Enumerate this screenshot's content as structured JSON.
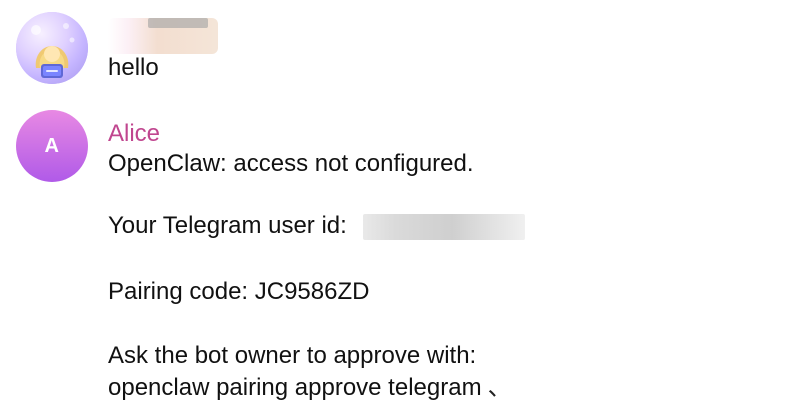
{
  "messages": [
    {
      "sender": "",
      "text": "hello"
    },
    {
      "sender": "Alice",
      "avatar_initial": "A",
      "lines": [
        "OpenClaw: access not configured.",
        "",
        "Your Telegram user id:",
        "",
        "Pairing code: JC9586ZD",
        "",
        "Ask the bot owner to approve with:",
        "openclaw pairing approve telegram"
      ],
      "trailing_glyph": "、"
    }
  ],
  "colors": {
    "alice_name": "#c0468f",
    "alice_avatar_top": "#e889e3",
    "alice_avatar_bottom": "#b05ae8"
  },
  "icons": {
    "user_avatar": "anime-character-avatar-icon",
    "alice_avatar": "initial-avatar-icon"
  }
}
